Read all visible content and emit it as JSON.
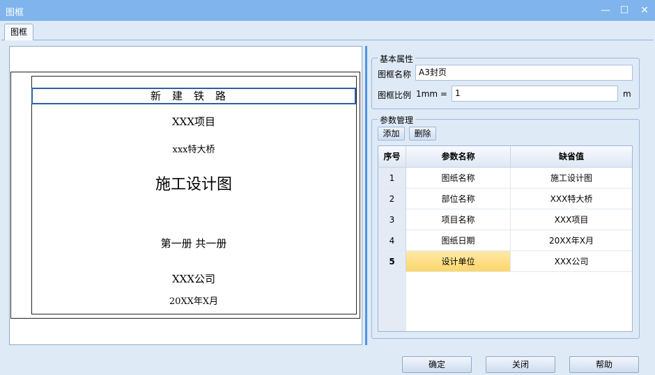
{
  "window": {
    "title": "图框",
    "min_glyph": "—",
    "max_glyph": "☐",
    "close_glyph": "✕"
  },
  "tabs": [
    {
      "label": "图框"
    }
  ],
  "preview": {
    "header": "新建铁路",
    "lines": [
      "XXX项目",
      "xxx特大桥",
      "施工设计图",
      "第一册  共一册",
      "XXX公司",
      "20XX年X月"
    ]
  },
  "basic": {
    "legend": "基本属性",
    "name_label": "图框名称",
    "name_value": "A3封页",
    "scale_label": "图框比例",
    "scale_prefix": "1mm =",
    "scale_value": "1",
    "scale_unit": "m"
  },
  "params": {
    "legend": "参数管理",
    "add_label": "添加",
    "delete_label": "删除",
    "columns": [
      "序号",
      "参数名称",
      "缺省值"
    ],
    "rows": [
      {
        "no": "1",
        "name": "图纸名称",
        "default": "施工设计图"
      },
      {
        "no": "2",
        "name": "部位名称",
        "default": "XXX特大桥"
      },
      {
        "no": "3",
        "name": "项目名称",
        "default": "XXX项目"
      },
      {
        "no": "4",
        "name": "图纸日期",
        "default": "20XX年X月"
      },
      {
        "no": "5",
        "name": "设计单位",
        "default": "XXX公司"
      }
    ],
    "selected_row": 5
  },
  "footer": {
    "ok_label": "确定",
    "close_label": "关闭",
    "help_label": "帮助"
  }
}
